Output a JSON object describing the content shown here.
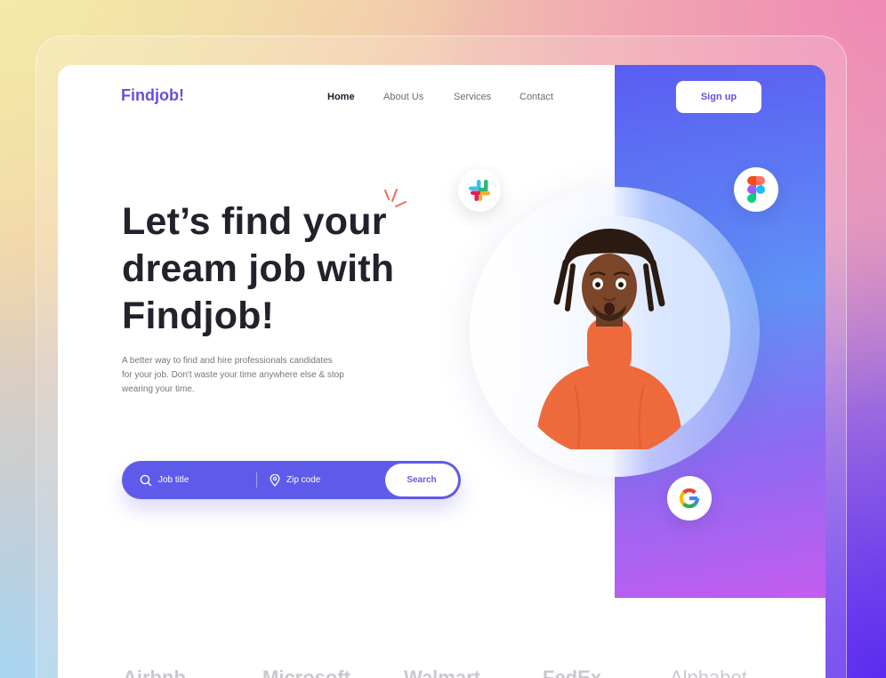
{
  "brand": {
    "name": "Findjob!",
    "accent": "#6052e0"
  },
  "nav": {
    "items": [
      {
        "label": "Home",
        "active": true
      },
      {
        "label": "About Us",
        "active": false
      },
      {
        "label": "Services",
        "active": false
      },
      {
        "label": "Contact",
        "active": false
      }
    ],
    "signup_label": "Sign up"
  },
  "hero": {
    "headline_lines": [
      "Let’s find your",
      "dream job with",
      "Findjob!"
    ],
    "description_lines": [
      "A better way to find and hire professionals candidates",
      "for your job. Don't waste your time anywhere else & stop",
      "wearing your time."
    ]
  },
  "search": {
    "job_placeholder": "Job title",
    "zip_placeholder": "Zip code",
    "button_label": "Search",
    "bar_color": "#5f5bea"
  },
  "floating_icons": [
    "slack-logo",
    "figma-logo",
    "google-logo"
  ],
  "partner_logos": [
    "Airbnb",
    "Microsoft",
    "Walmart",
    "FedEx",
    "Alphabet"
  ],
  "colors": {
    "panel_gradient": [
      "#5b5cf2",
      "#5f92f6",
      "#8d6af2",
      "#c45cf0"
    ],
    "headline": "#22222c",
    "sweater": "#ee6a3c"
  }
}
